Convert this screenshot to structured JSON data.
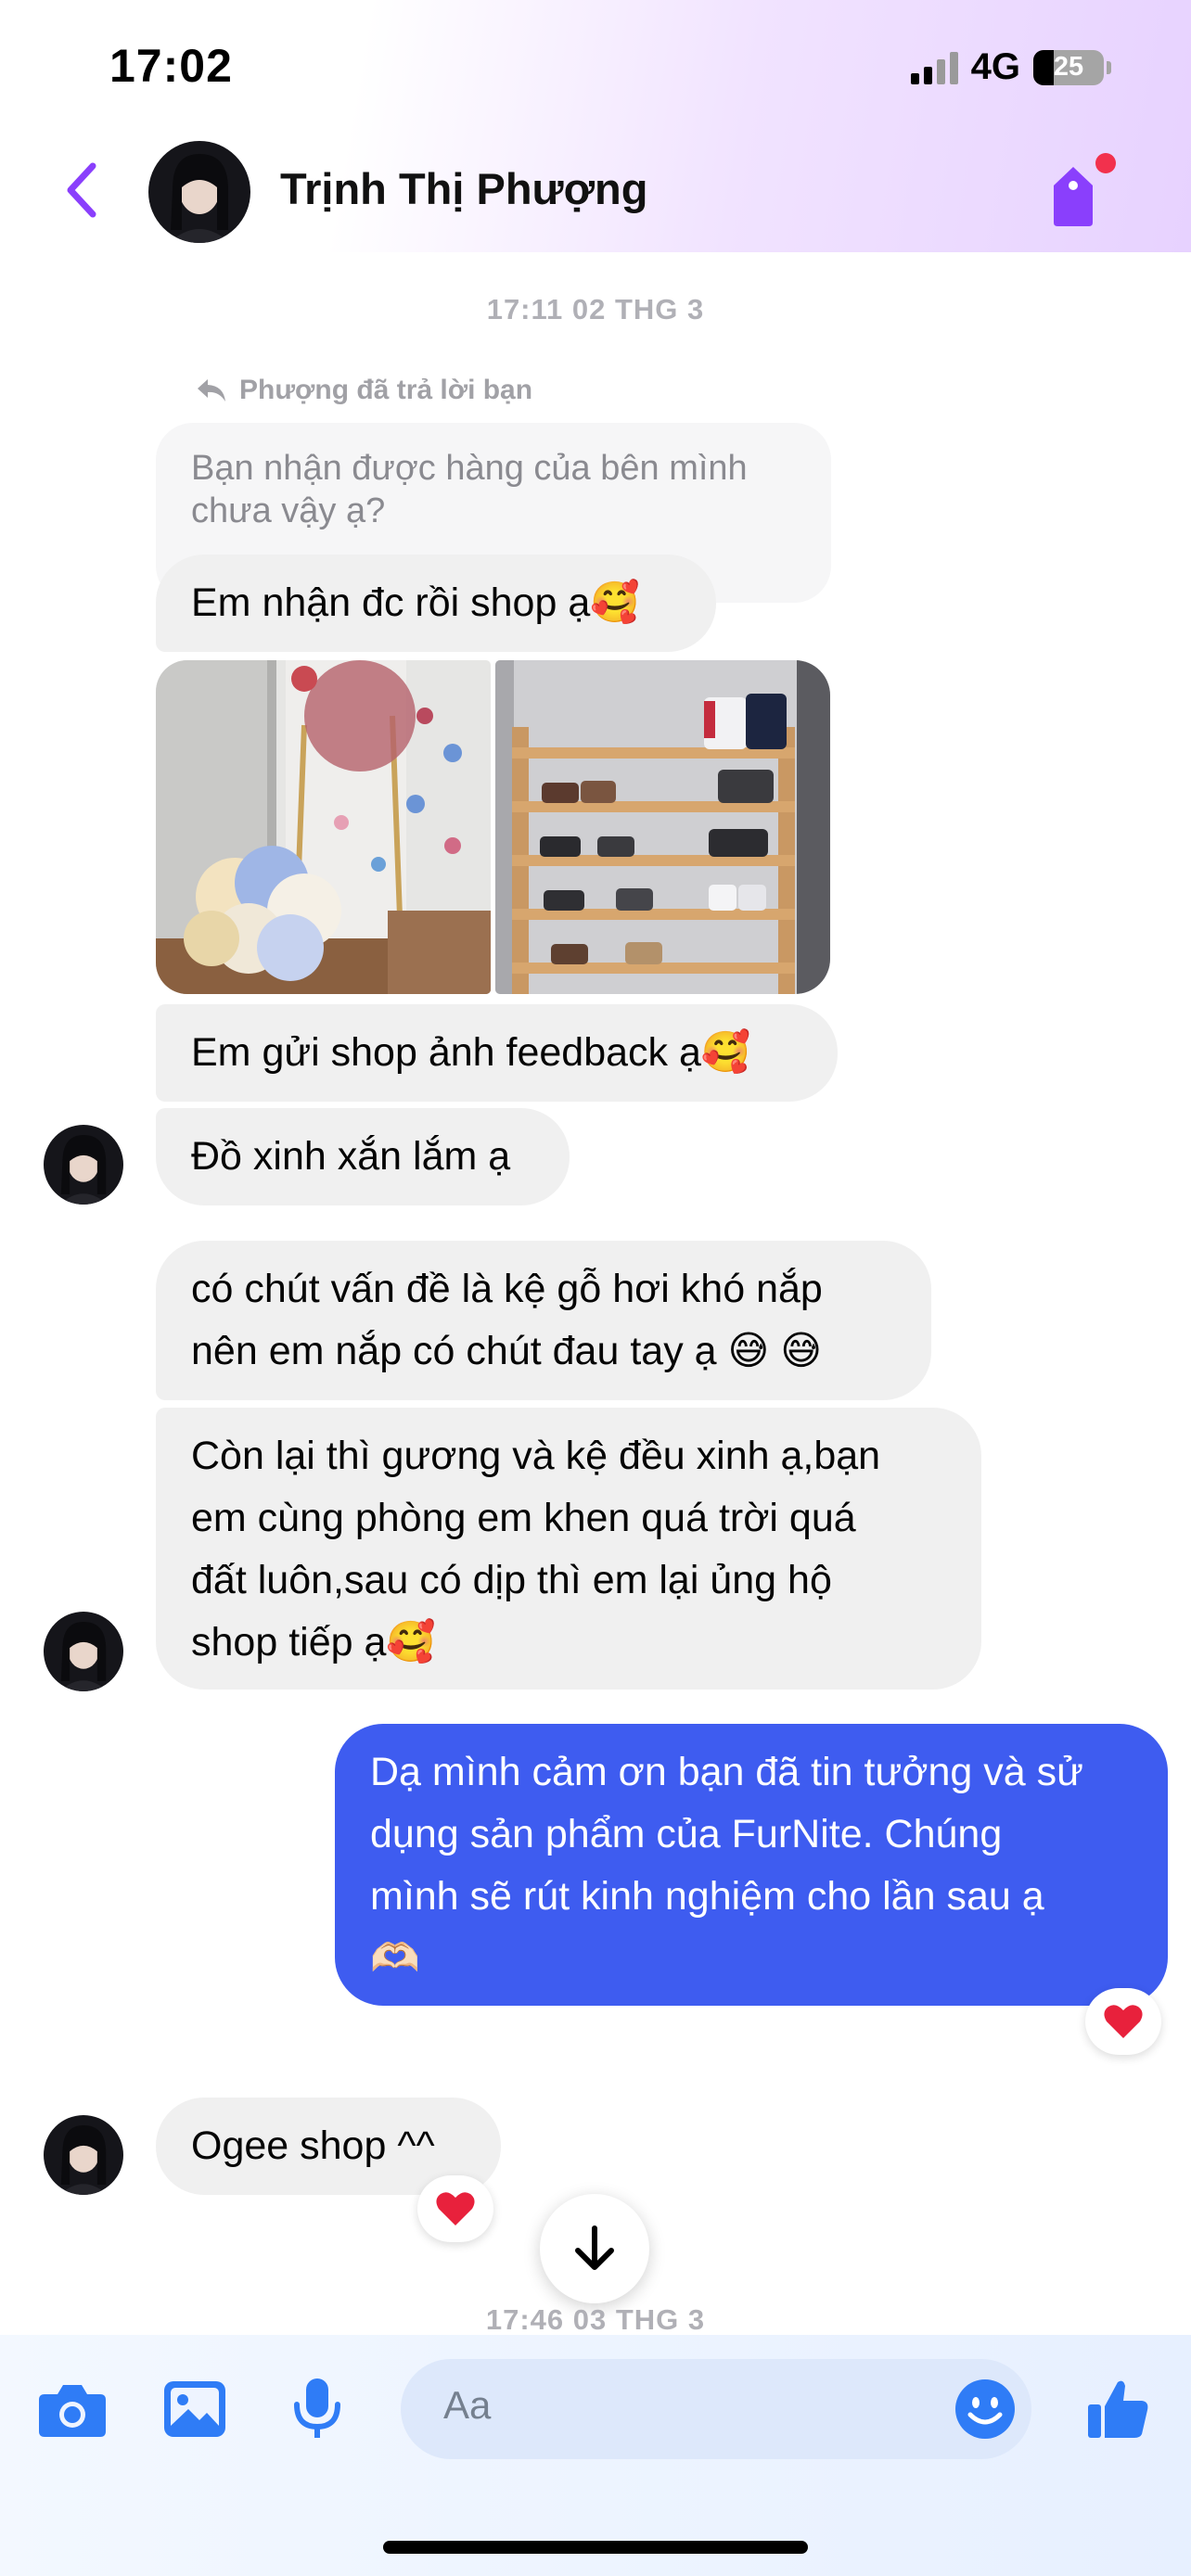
{
  "status": {
    "time": "17:02",
    "network": "4G",
    "battery": "25"
  },
  "header": {
    "contact_name": "Trịnh Thị Phượng"
  },
  "timestamps": {
    "first": "17:11 02 THG 3",
    "second": "17:46 03 THG 3"
  },
  "reply_note": "Phượng đã trả lời bạn",
  "messages": {
    "quoted": "Bạn nhận được hàng của bên mình chưa vậy ạ?",
    "m1": "Em nhận đc rồi shop ạ🥰",
    "m2": "Em gửi shop ảnh feedback ạ🥰",
    "m3": "Đồ xinh xắn lắm ạ",
    "m4_line1": "có chút vấn đề là kệ gỗ hơi khó nắp",
    "m4_line2": "nên em nắp có chút đau tay ạ 😅 😅",
    "m5_line1": "Còn lại thì gương và kệ đều xinh ạ,bạn",
    "m5_line2": "em cùng phòng em khen quá trời quá",
    "m5_line3": "đất luôn,sau có dịp thì em lại ủng hộ",
    "m5_line4": "shop tiếp ạ🥰",
    "out_line1": "Dạ mình cảm ơn bạn đã tin tưởng và sử",
    "out_line2": "dụng sản phẩm của FurNite. Chúng",
    "out_line3": "mình sẽ rút kinh nghiệm cho lần sau ạ",
    "out_line4": "🫶🏻",
    "m6": "Ogee shop ^^"
  },
  "composer": {
    "placeholder": "Aa"
  },
  "colors": {
    "accent": "#8a3ffc",
    "outgoing_bubble": "#3e5cf0",
    "toolbar_icons": "#2f7cf6",
    "incoming_bubble": "#f0f0f0"
  },
  "icons": {
    "back": "chevron-left-icon",
    "tag": "tag-icon",
    "reply": "reply-arrow-icon",
    "reaction": "heart-icon",
    "scroll": "arrow-down-icon",
    "camera": "camera-icon",
    "gallery": "image-icon",
    "mic": "microphone-icon",
    "emoji": "smiley-icon",
    "like": "thumbs-up-icon"
  }
}
